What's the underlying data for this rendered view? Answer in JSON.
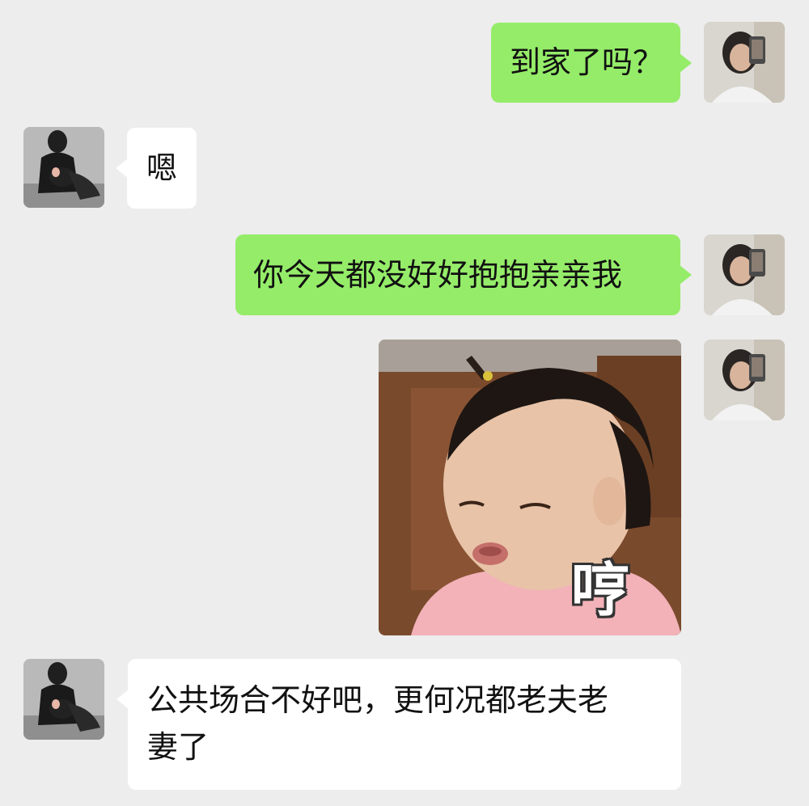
{
  "messages": [
    {
      "side": "me",
      "text": "到家了吗？"
    },
    {
      "side": "them",
      "text": "嗯"
    },
    {
      "side": "me",
      "text": "你今天都没好好抱抱亲亲我"
    },
    {
      "side": "me",
      "sticker": {
        "caption": "哼"
      }
    },
    {
      "side": "them",
      "text_line1": "公共场合不好吧，更何况都老夫老",
      "text_line2": "妻了"
    }
  ],
  "colors": {
    "background": "#ededed",
    "my_bubble": "#95ec69",
    "their_bubble": "#ffffff"
  }
}
